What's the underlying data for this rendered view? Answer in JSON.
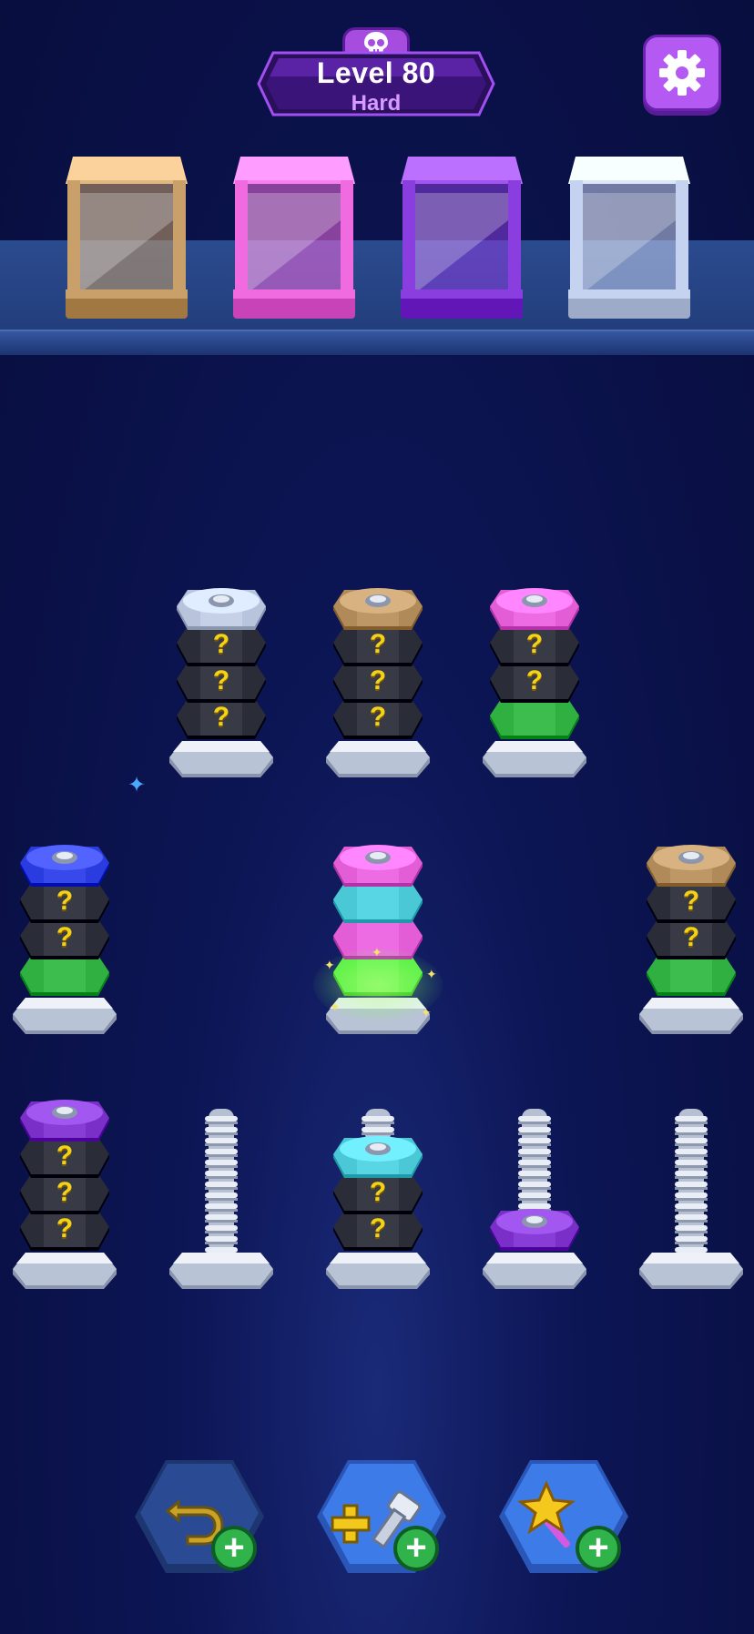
{
  "header": {
    "level_label": "Level 80",
    "difficulty": "Hard",
    "skull_icon": "skull-icon",
    "settings_icon": "gear-icon"
  },
  "boxes": [
    {
      "name": "tan-box",
      "color": "#c9a06a"
    },
    {
      "name": "pink-box",
      "color": "#f06ae0"
    },
    {
      "name": "purple-box",
      "color": "#8a3ee0"
    },
    {
      "name": "lightblue-box",
      "color": "#c5d2f0"
    }
  ],
  "colors": {
    "silver": "#b8c4dc",
    "tan": "#b08a58",
    "pink": "#e35ed6",
    "green": "#2fb040",
    "blue": "#2a3be0",
    "cyan": "#4ac8d6",
    "purple": "#7a30c8",
    "hidden": "#2a2d38",
    "bright_green": "#5ef04a"
  },
  "hidden_marker": "?",
  "rows": [
    [
      {
        "nuts": [
          "hidden",
          "hidden",
          "hidden",
          "silver"
        ]
      },
      {
        "nuts": [
          "hidden",
          "hidden",
          "hidden",
          "tan"
        ]
      },
      {
        "nuts": [
          "green",
          "hidden",
          "hidden",
          "pink"
        ]
      }
    ],
    [
      {
        "nuts": [
          "green",
          "hidden",
          "hidden",
          "blue"
        ]
      },
      {
        "nuts": [
          "bright_green",
          "pink",
          "cyan",
          "pink"
        ],
        "selected": true
      },
      {
        "nuts": [
          "green",
          "hidden",
          "hidden",
          "tan"
        ]
      }
    ],
    [
      {
        "nuts": [
          "hidden",
          "hidden",
          "hidden",
          "purple"
        ]
      },
      {
        "nuts": []
      },
      {
        "nuts": [
          "hidden",
          "hidden",
          "cyan"
        ]
      },
      {
        "nuts": [
          "purple"
        ]
      },
      {
        "nuts": []
      }
    ]
  ],
  "powerups": [
    {
      "name": "undo-button",
      "icon": "undo-arrow-icon",
      "plus": "+"
    },
    {
      "name": "add-bolt-button",
      "icon": "add-bolt-icon",
      "plus": "+"
    },
    {
      "name": "magic-wand-button",
      "icon": "star-wand-icon",
      "plus": "+"
    }
  ]
}
